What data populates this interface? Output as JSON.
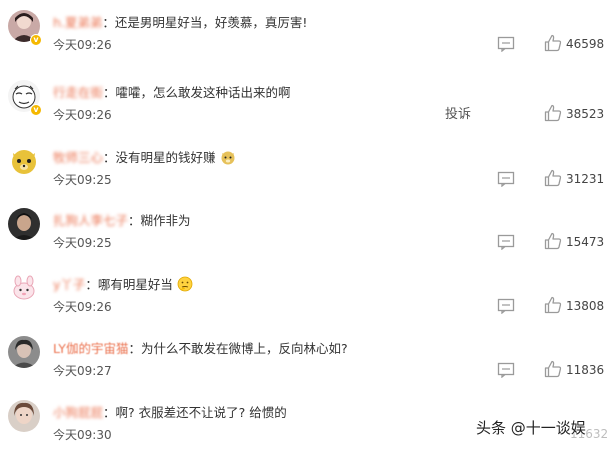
{
  "comments": [
    {
      "username": "h.夏弟弟",
      "text": "还是男明星好当，好羡慕，真厉害!",
      "time": "今天09:26",
      "likes": "46598",
      "verified": true
    },
    {
      "username": "行走在街",
      "text": "嚯嚯，怎么敢发这种话出来的啊",
      "time": "今天09:26",
      "likes": "38523",
      "verified": true,
      "report_label": "投诉"
    },
    {
      "username": "牧师三心",
      "text": "没有明星的钱好赚",
      "time": "今天09:25",
      "likes": "31231"
    },
    {
      "username": "扎狗人李七子",
      "text": "糊作非为",
      "time": "今天09:25",
      "likes": "15473"
    },
    {
      "username": "y丫子",
      "text": "哪有明星好当",
      "time": "今天09:26",
      "likes": "13808"
    },
    {
      "username": "LY伽的宇宙猫",
      "text": "为什么不敢发在微博上，反向林心如?",
      "time": "今天09:27",
      "likes": "11836"
    },
    {
      "username": "小狗屁屁",
      "text": "啊? 衣服差还不让说了? 给惯的",
      "time": "今天09:30",
      "likes": "11632"
    }
  ],
  "watermark": "头条 @十一谈娱",
  "colors": {
    "username": "#eb7350",
    "badge": "#f5b800",
    "icon": "#9a9a9a"
  }
}
